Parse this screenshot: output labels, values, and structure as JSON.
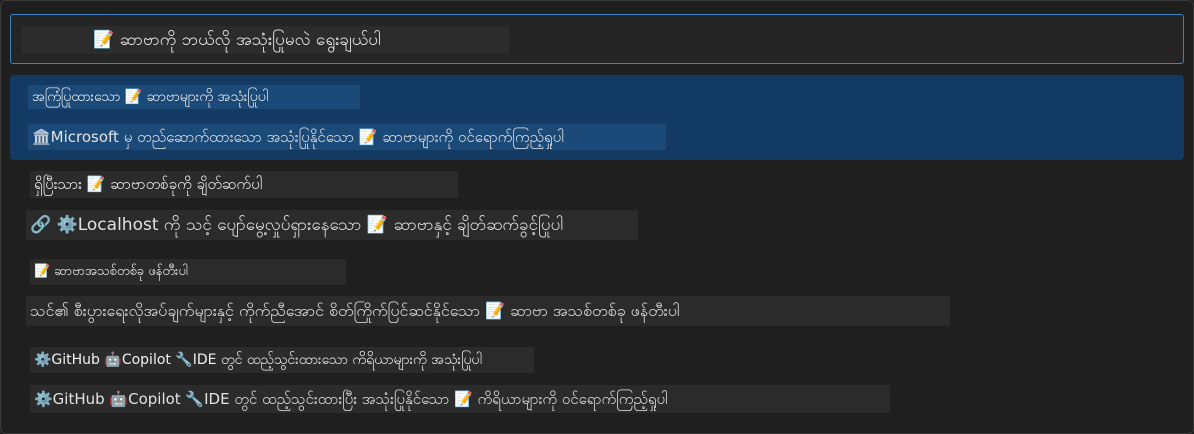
{
  "search": {
    "text": "📝 ဆာဗာကို ဘယ်လို အသုံးပြုမလဲ ရွေးချယ်ပါ"
  },
  "options": [
    {
      "title": "အကြံပြုထားသော 📝 ဆာဗာများကို အသုံးပြုပါ",
      "description": "🏛️Microsoft မှ တည်ဆောက်ထားသော အသုံးပြုနိုင်သော 📝 ဆာဗာများကို ဝင်ရောက်ကြည့်ရှုပါ",
      "selected": true
    },
    {
      "title": "ရှိပြီးသား 📝 ဆာဗာတစ်ခုကို ချိတ်ဆက်ပါ",
      "description": "🔗 ⚙️Localhost ကို သင့် ပျော်မွေ့လှုပ်ရှားနေသော 📝 ဆာဗာနှင့် ချိတ်ဆက်ခွင့်ပြုပါ",
      "selected": false
    },
    {
      "title": "📝 ဆာဗာအသစ်တစ်ခု ဖန်တီးပါ",
      "description": "သင်၏ စီးပွားရေးလိုအပ်ချက်များနှင့် ကိုက်ညီအောင် စိတ်ကြိုက်ပြင်ဆင်နိုင်သော 📝 ဆာဗာ အသစ်တစ်ခု ဖန်တီးပါ",
      "selected": false
    },
    {
      "title": "⚙️GitHub 🤖Copilot 🔧IDE တွင် ထည့်သွင်းထားသော ကိရိယာများကို အသုံးပြုပါ",
      "description": "⚙️GitHub 🤖Copilot 🔧IDE တွင် ထည့်သွင်းထားပြီး အသုံးပြုနိုင်သော 📝 ကိရိယာများကို ဝင်ရောက်ကြည့်ရှုပါ",
      "selected": false
    }
  ],
  "colors": {
    "background": "#1f1f1f",
    "focus_border": "#3b82c4",
    "selected_item": "#123a63"
  }
}
